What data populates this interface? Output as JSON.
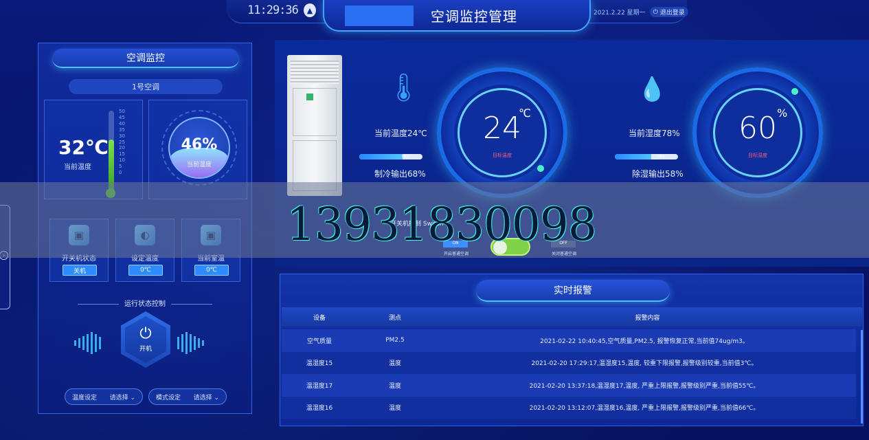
{
  "header": {
    "clock": "11:29:36",
    "title": "空调监控管理",
    "date": "2021.2.22 星期一",
    "logout_label": "退出登录"
  },
  "left_panel": {
    "title": "空调监控",
    "device_name": "1号空调",
    "temperature": {
      "value": "32℃",
      "label": "当前温度",
      "thermo_fraction": 0.64
    },
    "thermo_ticks": [
      "50",
      "45",
      "40",
      "35",
      "30",
      "25",
      "20",
      "15",
      "10",
      "5",
      "0"
    ],
    "humidity": {
      "value": "46%",
      "label": "当前湿度",
      "fill_fraction": 0.46
    },
    "status_cards": [
      {
        "label": "开关机状态",
        "value": "关机",
        "icon": "power-status-icon"
      },
      {
        "label": "设定温度",
        "value": "0℃",
        "icon": "thermometer-gauge-icon"
      },
      {
        "label": "当前室温",
        "value": "0℃",
        "icon": "room-temp-icon"
      }
    ],
    "control_title": "运行状态控制",
    "power_label": "开机",
    "selects": [
      {
        "label": "温度设定",
        "value": "请选择"
      },
      {
        "label": "模式设定",
        "value": "请选择"
      }
    ]
  },
  "monitor": {
    "temp_text": "当前温度24℃",
    "cooling_text": "制冷输出68%",
    "cooling_progress_label": "68%",
    "cooling_fraction": 0.68,
    "target_temp": "24",
    "target_temp_unit": "℃",
    "target_temp_label": "目标温度",
    "humid_text": "当前湿度78%",
    "dehumid_text": "除湿输出58%",
    "dehumid_progress_label": "58%",
    "dehumid_fraction": 0.58,
    "target_humid": "60",
    "target_humid_unit": "%",
    "target_humid_label": "目标湿度",
    "switch_text": "开关机控制 Switch",
    "on_label": "ON",
    "on_caption": "开启普通空调",
    "off_label": "OFF",
    "off_caption": "关闭普通空调"
  },
  "overlay": {
    "phone": "13931830098"
  },
  "alarm": {
    "title": "实时报警",
    "columns": [
      "设备",
      "测点",
      "报警内容"
    ],
    "rows": [
      [
        "空气质量",
        "PM2.5",
        "2021-02-22 10:40:45,空气质量,PM2.5, 报警恢复正常,当前值74ug/m3。"
      ],
      [
        "温湿度15",
        "温度",
        "2021-02-20 17:29:17,温湿度15,温度, 较重下限报警,报警级别较重,当前值3℃。"
      ],
      [
        "温湿度17",
        "温度",
        "2021-02-20 13:37:18,温湿度17,温度, 严重上限报警,报警级别严重,当前值55℃。"
      ],
      [
        "温湿度16",
        "温度",
        "2021-02-20 13:12:07,温湿度16,温度, 严重上限报警,报警级别严重,当前值66℃。"
      ]
    ]
  }
}
